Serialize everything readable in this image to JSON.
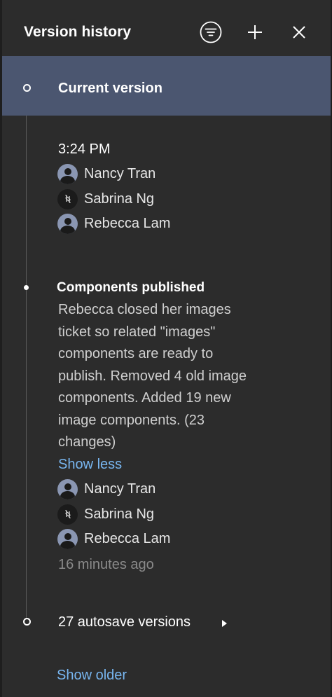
{
  "header": {
    "title": "Version history",
    "icons": {
      "filter": "filter-icon",
      "add": "plus-icon",
      "close": "close-icon"
    }
  },
  "current_version": {
    "label": "Current version"
  },
  "recent": {
    "time": "3:24 PM",
    "users": [
      {
        "name": "Nancy Tran",
        "avatar": "person-avatar"
      },
      {
        "name": "Sabrina Ng",
        "avatar": "logo-avatar"
      },
      {
        "name": "Rebecca Lam",
        "avatar": "person-avatar"
      }
    ]
  },
  "published": {
    "title": "Components published",
    "description_lines": [
      "Rebecca closed her images",
      "ticket so related \"images\"",
      "components are ready to",
      "publish. Removed 4 old image",
      "components. Added 19 new",
      "image components. (23",
      "changes)"
    ],
    "show_less": "Show less",
    "users": [
      {
        "name": "Nancy Tran",
        "avatar": "person-avatar"
      },
      {
        "name": "Sabrina Ng",
        "avatar": "logo-avatar"
      },
      {
        "name": "Rebecca Lam",
        "avatar": "person-avatar"
      }
    ],
    "time_ago": "16 minutes ago"
  },
  "autosave": {
    "label": "27 autosave versions"
  },
  "show_older": "Show older",
  "colors": {
    "panel_bg": "#2c2c2c",
    "current_row_bg": "#4b5670",
    "link": "#78b6f0",
    "muted": "#8a8a8a"
  }
}
